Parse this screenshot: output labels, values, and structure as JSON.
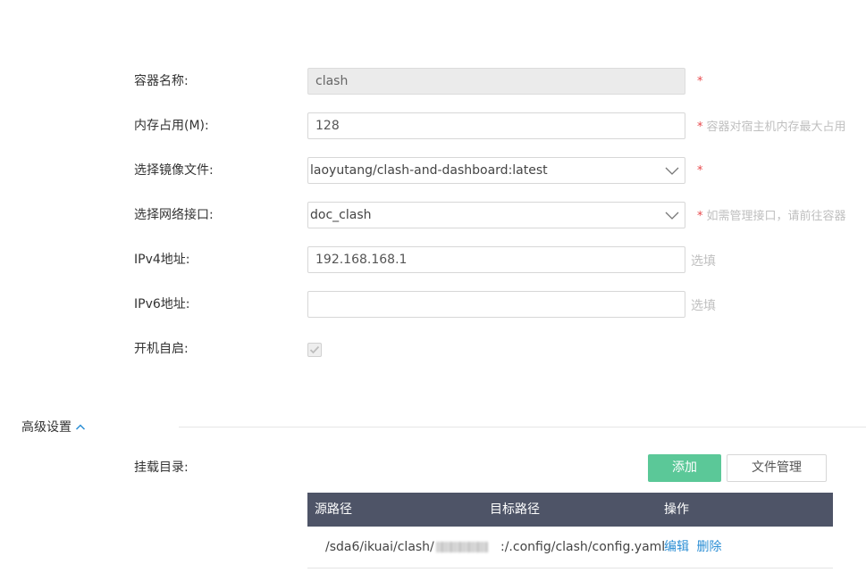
{
  "form": {
    "container_name": {
      "label": "容器名称:",
      "value": "clash",
      "required": "*"
    },
    "memory": {
      "label": "内存占用(M):",
      "value": "128",
      "required": "*",
      "hint": "容器对宿主机内存最大占用"
    },
    "image": {
      "label": "选择镜像文件:",
      "value": "laoyutang/clash-and-dashboard:latest",
      "required": "*",
      "icon": "chevron-down-icon"
    },
    "network": {
      "label": "选择网络接口:",
      "value": "doc_clash",
      "required": "*",
      "hint": "如需管理接口，请前往容器",
      "icon": "chevron-down-icon"
    },
    "ipv4": {
      "label": "IPv4地址:",
      "value": "192.168.168.1",
      "optional": "选填"
    },
    "ipv6": {
      "label": "IPv6地址:",
      "value": "",
      "optional": "选填"
    },
    "autostart": {
      "label": "开机自启:",
      "checked": true
    }
  },
  "advanced": {
    "title": "高级设置",
    "icon": "chevron-up-icon"
  },
  "mount": {
    "label": "挂载目录:",
    "add_button": "添加",
    "file_manager_button": "文件管理",
    "columns": [
      "源路径",
      "目标路径",
      "操作"
    ],
    "rows": [
      {
        "source_prefix": "/sda6/ikuai/clash/",
        "target": ":/.config/clash/config.yaml",
        "edit": "编辑",
        "delete": "删除"
      }
    ]
  },
  "colors": {
    "accent_green": "#5bc898",
    "table_header": "#4e5467",
    "link_blue": "#2d8fd5",
    "required_red": "#e8484b"
  }
}
